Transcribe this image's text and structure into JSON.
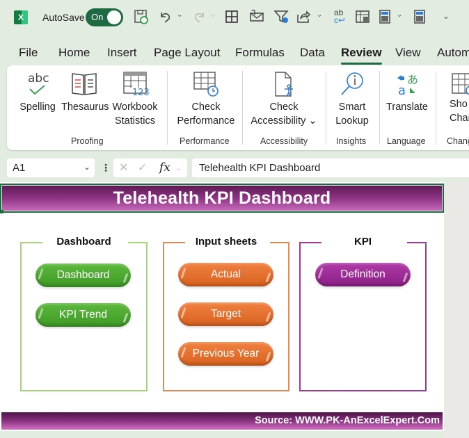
{
  "qat": {
    "autosave_label": "AutoSave",
    "autosave_state": "On",
    "icons": [
      "excel-logo",
      "save-sync-icon",
      "undo-icon",
      "redo-icon",
      "borders-icon",
      "attach-email-icon",
      "filter-settings-icon",
      "share-icon",
      "spelling-replace-icon",
      "form-icon",
      "calculator-icon",
      "calculator-icon",
      "customize-qat-icon"
    ]
  },
  "tabs": [
    {
      "label": "File"
    },
    {
      "label": "Home"
    },
    {
      "label": "Insert"
    },
    {
      "label": "Page Layout"
    },
    {
      "label": "Formulas"
    },
    {
      "label": "Data"
    },
    {
      "label": "Review",
      "active": true
    },
    {
      "label": "View"
    },
    {
      "label": "Autom"
    }
  ],
  "ribbon": {
    "groups": [
      {
        "label": "Proofing",
        "buttons": [
          {
            "line1": "Spelling",
            "line2": ""
          },
          {
            "line1": "Thesaurus",
            "line2": ""
          },
          {
            "line1": "Workbook",
            "line2": "Statistics"
          }
        ]
      },
      {
        "label": "Performance",
        "buttons": [
          {
            "line1": "Check",
            "line2": "Performance"
          }
        ]
      },
      {
        "label": "Accessibility",
        "buttons": [
          {
            "line1": "Check",
            "line2": "Accessibility ⌄"
          }
        ]
      },
      {
        "label": "Insights",
        "buttons": [
          {
            "line1": "Smart",
            "line2": "Lookup"
          }
        ]
      },
      {
        "label": "Language",
        "buttons": [
          {
            "line1": "Translate",
            "line2": ""
          }
        ]
      },
      {
        "label": "Chang",
        "buttons": [
          {
            "line1": "Sho",
            "line2": "Chang"
          }
        ]
      }
    ]
  },
  "formula_bar": {
    "name_box": "A1",
    "fx": "fx",
    "formula": "Telehealth KPI Dashboard"
  },
  "sheet": {
    "title": "Telehealth KPI Dashboard",
    "panels": [
      {
        "title": "Dashboard",
        "color": "#a6d47c",
        "buttons": [
          "Dashboard",
          "KPI Trend"
        ]
      },
      {
        "title": "Input sheets",
        "color": "#e08a55",
        "buttons": [
          "Actual",
          "Target",
          "Previous Year"
        ]
      },
      {
        "title": "KPI",
        "color": "#9b3b95",
        "buttons": [
          "Definition"
        ]
      }
    ],
    "footer": "Source: WWW.PK-AnExcelExpert.Com"
  },
  "colors": {
    "accent_green": "#1e6b43",
    "banner_purple": "#8e3485",
    "pill_green": "#4caa2f",
    "pill_orange": "#e8712e",
    "pill_purple": "#9d2c97"
  }
}
